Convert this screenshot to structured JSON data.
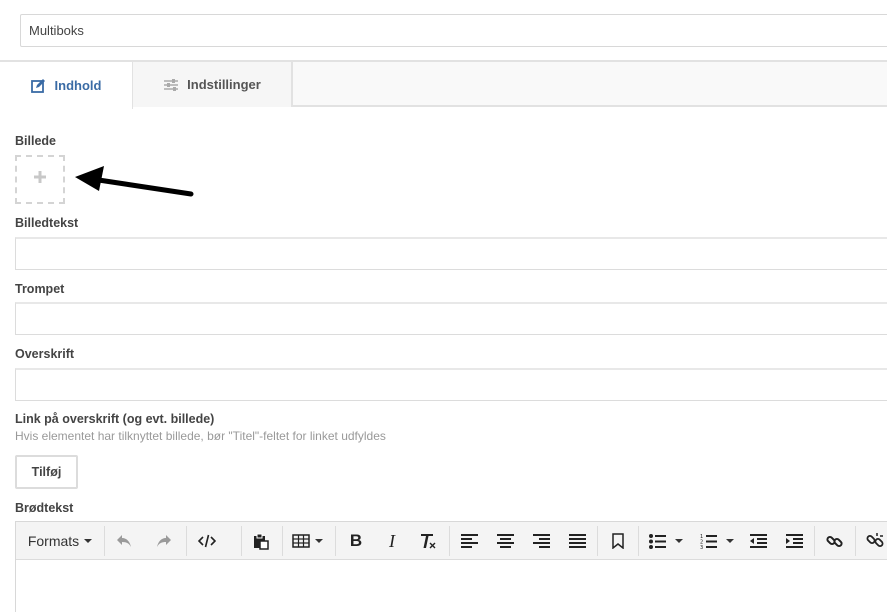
{
  "name_field": {
    "value": "Multiboks"
  },
  "tabs": [
    {
      "label": "Indhold",
      "active": true,
      "icon": "edit-icon"
    },
    {
      "label": "Indstillinger",
      "active": false,
      "icon": "sliders-icon"
    }
  ],
  "fields": {
    "image_label": "Billede",
    "caption_label": "Billedtekst",
    "trumpet_label": "Trompet",
    "heading_label": "Overskrift",
    "link_label": "Link på overskrift (og evt. billede)",
    "link_hint": "Hvis elementet har tilknyttet billede, bør \"Titel\"-feltet for linket udfyldes",
    "add_button": "Tilføj",
    "body_label": "Brødtekst"
  },
  "editor": {
    "formats_label": "Formats",
    "tools": [
      "undo-icon",
      "redo-icon",
      "source-code-icon",
      "paste-icon",
      "table-icon",
      "bold-icon",
      "italic-icon",
      "clear-format-icon",
      "align-left-icon",
      "align-center-icon",
      "align-right-icon",
      "justify-icon",
      "bookmark-icon",
      "bullet-list-icon",
      "numbered-list-icon",
      "outdent-icon",
      "indent-icon",
      "link-icon",
      "unlink-icon"
    ]
  },
  "colors": {
    "accent": "#3a6ba5",
    "border": "#dcdcdc"
  }
}
